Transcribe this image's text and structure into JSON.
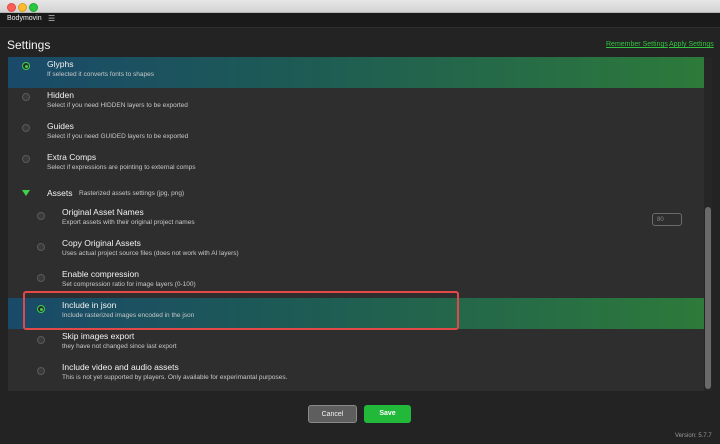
{
  "app": {
    "name": "Bodymovin",
    "menu_icon": "hamburger-menu-icon"
  },
  "page": {
    "title": "Settings"
  },
  "links": {
    "remember": "Remember Settings",
    "apply": "Apply Settings"
  },
  "settings": [
    {
      "label": "Glyphs",
      "desc": "If selected it converts fonts to shapes",
      "checked": true,
      "selected": true
    },
    {
      "label": "Hidden",
      "desc": "Select if you need HIDDEN layers to be exported",
      "checked": false
    },
    {
      "label": "Guides",
      "desc": "Select if you need GUIDED layers to be exported",
      "checked": false
    },
    {
      "label": "Extra Comps",
      "desc": "Select if expressions are pointing to external comps",
      "checked": false
    }
  ],
  "assets": {
    "label": "Assets",
    "desc": "Rasterized assets settings (jpg, png)",
    "expanded": true,
    "items": [
      {
        "label": "Original Asset Names",
        "desc": "Export assets with their original project names",
        "checked": false
      },
      {
        "label": "Copy Original Assets",
        "desc": "Uses actual project source files (does not work with AI layers)",
        "checked": false
      },
      {
        "label": "Enable compression",
        "desc": "Set compression ratio for image layers (0-100)",
        "checked": false,
        "value": "80"
      },
      {
        "label": "Include in json",
        "desc": "Include rasterized images encoded in the json",
        "checked": true,
        "selected": true
      },
      {
        "label": "Skip images export",
        "desc": "they have not changed since last export",
        "checked": false
      },
      {
        "label": "Include video and audio assets",
        "desc": "This is not yet supported by players. Only available for experimantal purposes.",
        "checked": false
      }
    ]
  },
  "buttons": {
    "cancel": "Cancel",
    "save": "Save"
  },
  "version": "Version: 5.7.7",
  "colors": {
    "accent": "#3fd24a",
    "highlight_border": "#e24848",
    "background": "#232323",
    "panel": "#2e2e2e"
  }
}
